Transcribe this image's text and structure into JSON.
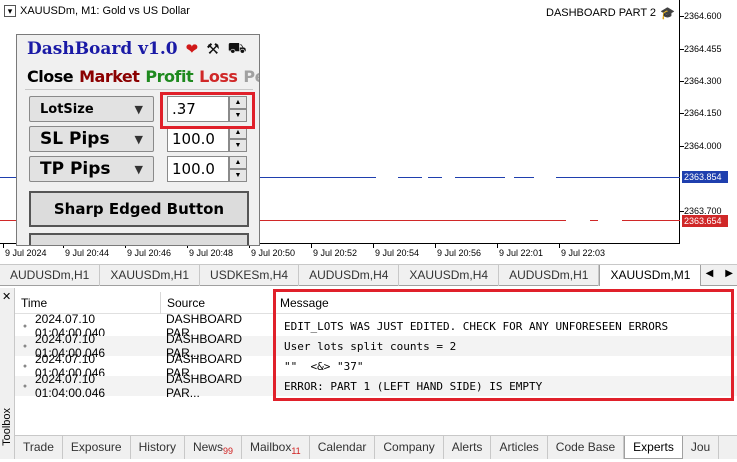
{
  "chart": {
    "title": "XAUUSDm, M1:  Gold vs US Dollar",
    "dashboard_part_label": "DASHBOARD PART 2",
    "price_ticks": [
      "2364.600",
      "2364.455",
      "2364.300",
      "2364.150",
      "2364.000",
      "2363.854",
      "2363.700",
      "2363.654"
    ],
    "time_ticks": [
      "9 Jul 2024",
      "9 Jul 20:44",
      "9 Jul 20:46",
      "9 Jul 20:48",
      "9 Jul 20:50",
      "9 Jul 20:52",
      "9 Jul 20:54",
      "9 Jul 20:56",
      "9 Jul 22:01",
      "9 Jul 22:03"
    ],
    "bid_badge": "2363.854",
    "ask_badge": "2363.654",
    "bid_color": "#1f3fae",
    "ask_color": "#d02828"
  },
  "dashboard": {
    "title": "DashBoard v1.0",
    "header_icons": [
      "heart-icon",
      "tools-icon",
      "truck-icon"
    ],
    "tabs": [
      {
        "label": "Close",
        "color": "#000000"
      },
      {
        "label": "Market",
        "color": "#8b0000"
      },
      {
        "label": "Profit",
        "color": "#1f8a1f"
      },
      {
        "label": "Loss",
        "color": "#d02828"
      },
      {
        "label": "Pend'n",
        "color": "#a0a0a0"
      }
    ],
    "lotsize": {
      "label": "LotSize",
      "value": ".37"
    },
    "sl": {
      "label": "SL Pips",
      "value": "100.0"
    },
    "tp": {
      "label": "TP Pips",
      "value": "100.0"
    },
    "sharp_button": "Sharp Edged Button"
  },
  "symbol_tabs": [
    "AUDUSDm,H1",
    "XAUUSDm,H1",
    "USDKESm,H4",
    "AUDUSDm,H4",
    "XAUUSDm,H4",
    "AUDUSDm,H1",
    "XAUUSDm,M1"
  ],
  "active_symbol_tab": "XAUUSDm,M1",
  "toolbox": {
    "side_label": "Toolbox",
    "columns": [
      "Time",
      "Source",
      "Message"
    ],
    "rows": [
      {
        "time": "2024.07.10 01:04:00.040",
        "source": "DASHBOARD PAR...",
        "message": "EDIT_LOTS WAS JUST EDITED. CHECK FOR ANY UNFORESEEN ERRORS"
      },
      {
        "time": "2024.07.10 01:04:00.046",
        "source": "DASHBOARD PAR...",
        "message": "User lots split counts = 2"
      },
      {
        "time": "2024.07.10 01:04:00.046",
        "source": "DASHBOARD PAR...",
        "message": "\"\"  <&> \"37\""
      },
      {
        "time": "2024.07.10 01:04:00.046",
        "source": "DASHBOARD PAR...",
        "message": "ERROR: PART 1 (LEFT HAND SIDE) IS EMPTY"
      }
    ],
    "bottom_tabs": [
      {
        "label": "Trade",
        "badge": ""
      },
      {
        "label": "Exposure",
        "badge": ""
      },
      {
        "label": "History",
        "badge": ""
      },
      {
        "label": "News",
        "badge": "99"
      },
      {
        "label": "Mailbox",
        "badge": "11"
      },
      {
        "label": "Calendar",
        "badge": ""
      },
      {
        "label": "Company",
        "badge": ""
      },
      {
        "label": "Alerts",
        "badge": ""
      },
      {
        "label": "Articles",
        "badge": ""
      },
      {
        "label": "Code Base",
        "badge": ""
      },
      {
        "label": "Experts",
        "badge": ""
      },
      {
        "label": "Jou",
        "badge": ""
      }
    ],
    "active_bottom_tab": "Experts"
  },
  "highlight_color": "#e0202a"
}
